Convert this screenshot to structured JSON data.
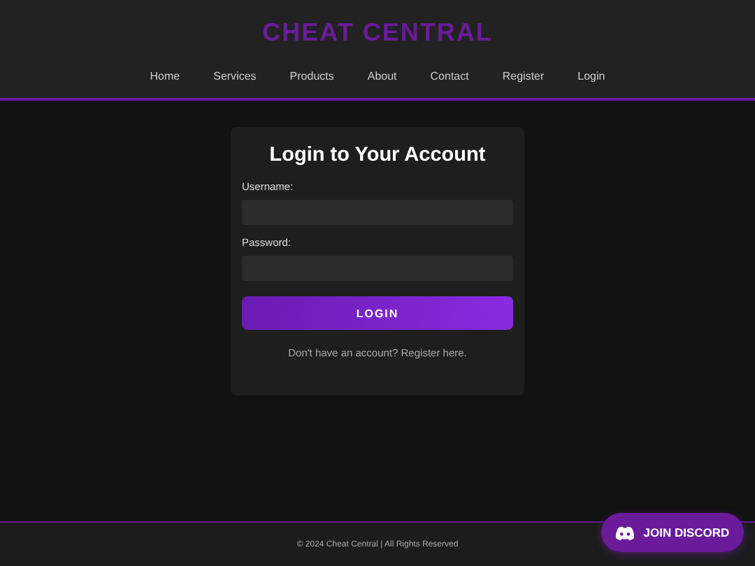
{
  "header": {
    "logo": "CHEAT CENTRAL",
    "nav": [
      "Home",
      "Services",
      "Products",
      "About",
      "Contact",
      "Register",
      "Login"
    ]
  },
  "login_form": {
    "title": "Login to Your Account",
    "fields": [
      {
        "label": "Username:"
      },
      {
        "label": "Password:"
      }
    ],
    "submit": "LOGIN",
    "register_prompt": "Don't have an account? Register here."
  },
  "footer": {
    "text": "© 2024 Cheat Central | All Rights Reserved"
  },
  "discord_button": {
    "label": "JOIN DISCORD"
  }
}
